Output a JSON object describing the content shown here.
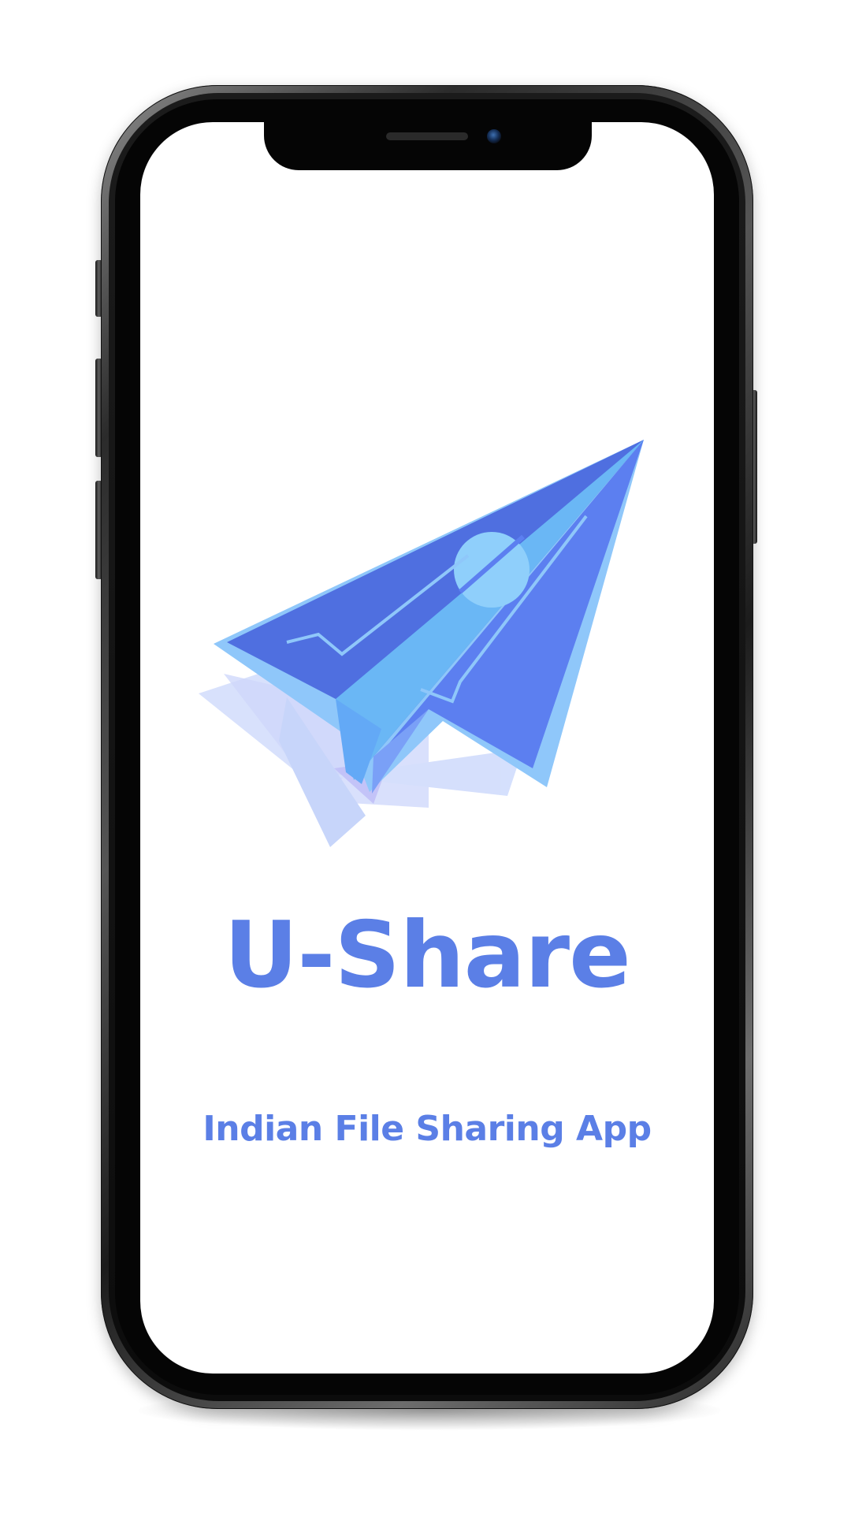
{
  "app": {
    "name": "U-Share",
    "tagline": "Indian File Sharing App"
  },
  "logo": {
    "icon": "paper-plane-icon"
  },
  "colors": {
    "brand": "#5b7fe6",
    "plane_dark": "#4f6fe0",
    "plane_mid": "#6a8ff0",
    "plane_light": "#8fc7fa",
    "plane_edge": "#6ab7f5",
    "background": "#ffffff",
    "device_frame": "#1a1a1a"
  }
}
